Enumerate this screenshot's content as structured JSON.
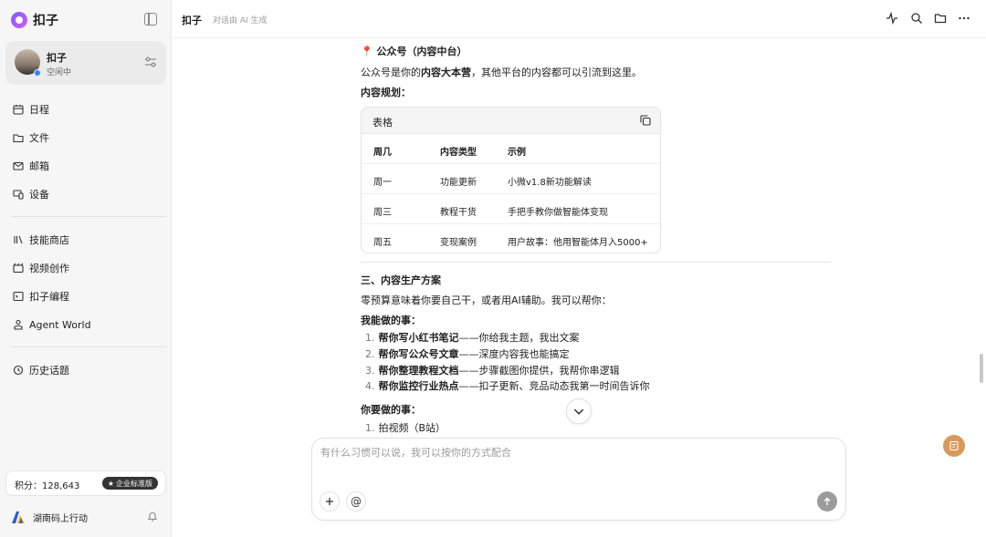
{
  "app": {
    "name": "扣子"
  },
  "profile": {
    "name": "扣子",
    "status": "空闲中"
  },
  "nav_primary": [
    {
      "label": "日程",
      "icon": "calendar-icon"
    },
    {
      "label": "文件",
      "icon": "folder-icon"
    },
    {
      "label": "邮箱",
      "icon": "mail-icon"
    },
    {
      "label": "设备",
      "icon": "device-icon"
    }
  ],
  "nav_secondary": [
    {
      "label": "技能商店",
      "icon": "library-icon"
    },
    {
      "label": "视频创作",
      "icon": "video-icon"
    },
    {
      "label": "扣子编程",
      "icon": "code-icon"
    },
    {
      "label": "Agent World",
      "icon": "agent-icon"
    }
  ],
  "nav_history": {
    "label": "历史话题",
    "icon": "history-icon"
  },
  "points": {
    "label": "积分：128,643",
    "badge": "企业标准版"
  },
  "org": {
    "name": "湖南码上行动"
  },
  "header": {
    "title": "扣子",
    "subtitle": "对话由 AI 生成"
  },
  "content": {
    "section_title": "📍 公众号（内容中台）",
    "intro_prefix": "公众号是你的",
    "intro_bold": "内容大本营",
    "intro_suffix": "，其他平台的内容都可以引流到这里。",
    "planning_label": "内容规划：",
    "table": {
      "title": "表格",
      "headers": [
        "周几",
        "内容类型",
        "示例"
      ],
      "rows": [
        [
          "周一",
          "功能更新",
          "小微v1.8新功能解读"
        ],
        [
          "周三",
          "教程干货",
          "手把手教你做智能体变现"
        ],
        [
          "周五",
          "变现案例",
          "用户故事：他用智能体月入5000+"
        ]
      ]
    },
    "section3_title": "三、内容生产方案",
    "section3_intro": "零预算意味着你要自己干，或者用AI辅助。我可以帮你：",
    "can_do_label": "我能做的事：",
    "can_do": [
      {
        "num": "1.",
        "bold": "帮你写小红书笔记",
        "rest": "——你给我主题，我出文案"
      },
      {
        "num": "2.",
        "bold": "帮你写公众号文章",
        "rest": "——深度内容我也能搞定"
      },
      {
        "num": "3.",
        "bold": "帮你整理教程文档",
        "rest": "——步骤截图你提供，我帮你串逻辑"
      },
      {
        "num": "4.",
        "bold": "帮你监控行业热点",
        "rest": "——扣子更新、竞品动态我第一时间告诉你"
      }
    ],
    "you_do_label": "你要做的事：",
    "you_do": [
      {
        "num": "1.",
        "text": "拍视频（B站）"
      }
    ]
  },
  "composer": {
    "placeholder": "有什么习惯可以说，我可以按你的方式配合"
  }
}
